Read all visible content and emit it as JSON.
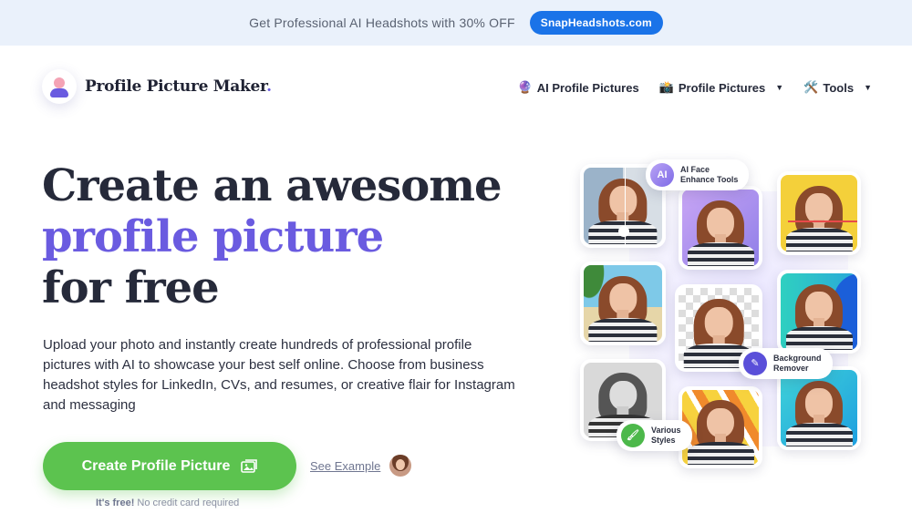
{
  "promo": {
    "text": "Get Professional AI Headshots with 30% OFF",
    "button_label": "SnapHeadshots.com"
  },
  "header": {
    "logo_text": "Profile Picture Maker",
    "logo_dot": "."
  },
  "nav": {
    "items": [
      {
        "emoji": "🔮",
        "label": "AI Profile Pictures",
        "has_dropdown": false
      },
      {
        "emoji": "📸",
        "label": "Profile Pictures",
        "has_dropdown": true
      },
      {
        "emoji": "🛠️",
        "label": "Tools",
        "has_dropdown": true
      }
    ]
  },
  "hero": {
    "title_line1": "Create an awesome",
    "title_line2": "profile picture",
    "title_line3": "for free",
    "description": "Upload your photo and instantly create hundreds of professional profile pictures with AI to showcase your best self online. Choose from business headshot styles for LinkedIn, CVs, and resumes, or creative flair for Instagram and messaging",
    "cta_label": "Create Profile Picture",
    "see_example": "See Example",
    "free_bold": "It's free!",
    "free_rest": " No credit card required"
  },
  "collage": {
    "badges": [
      {
        "icon": "AI",
        "line1": "AI Face",
        "line2": "Enhance Tools"
      },
      {
        "icon": "✎",
        "line1": "Background",
        "line2": "Remover"
      },
      {
        "icon": "🖌",
        "line1": "Various",
        "line2": "Styles"
      }
    ]
  },
  "colors": {
    "accent": "#6a5be0",
    "cta": "#5cc34f",
    "promo_button": "#1a73e8",
    "promo_bg": "#eaf1fb"
  }
}
